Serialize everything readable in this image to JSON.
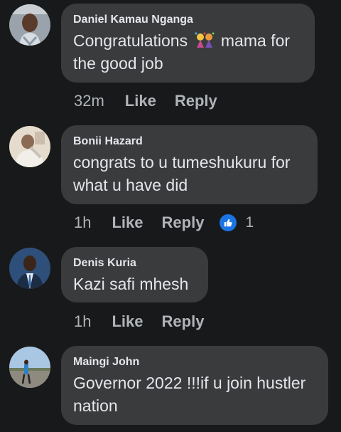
{
  "comments": [
    {
      "author": "Daniel Kamau Nganga",
      "text_before_emoji": "Congratulations ",
      "emoji": "party-popper-icon",
      "text_after_emoji": " mama for\nthe good job",
      "time": "32m",
      "like_label": "Like",
      "reply_label": "Reply"
    },
    {
      "author": "Bonii Hazard",
      "text": "congrats to u tumeshukuru for\nwhat u have did",
      "time": "1h",
      "like_label": "Like",
      "reply_label": "Reply",
      "reaction_count": "1"
    },
    {
      "author": "Denis Kuria",
      "text": "Kazi safi mhesh",
      "time": "1h",
      "like_label": "Like",
      "reply_label": "Reply"
    },
    {
      "author": "Maingi John",
      "text": "Governor 2022 !!!if u join hustler\nnation"
    }
  ],
  "colors": {
    "background": "#18191a",
    "bubble": "#3a3b3c",
    "primary_text": "#e4e6eb",
    "secondary_text": "#b0b3b8",
    "like_blue": "#1b74e4"
  }
}
